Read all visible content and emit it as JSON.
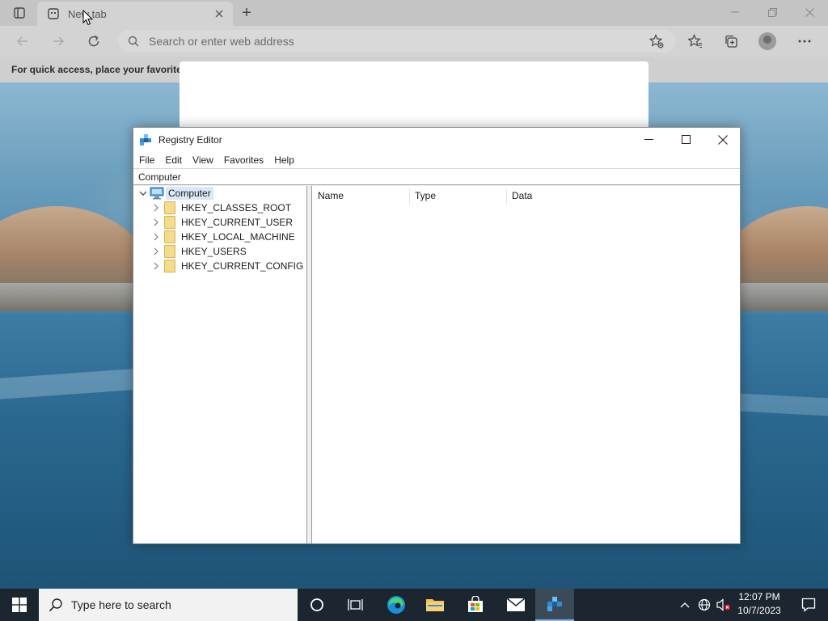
{
  "browser": {
    "tab_title": "New tab",
    "new_tab_symbol": "+",
    "address_placeholder": "Search or enter web address",
    "favorites_bar_text": "For quick access, place your favorites h",
    "icons": [
      "tab-actions-icon",
      "back-icon",
      "forward-icon",
      "refresh-icon",
      "search-icon",
      "add-favorite-icon",
      "favorites-icon",
      "collections-icon",
      "profile-icon",
      "more-icon"
    ]
  },
  "regedit": {
    "title": "Registry Editor",
    "menus": [
      "File",
      "Edit",
      "View",
      "Favorites",
      "Help"
    ],
    "address_path": "Computer",
    "tree_root": "Computer",
    "tree_items": [
      "HKEY_CLASSES_ROOT",
      "HKEY_CURRENT_USER",
      "HKEY_LOCAL_MACHINE",
      "HKEY_USERS",
      "HKEY_CURRENT_CONFIG"
    ],
    "columns": [
      "Name",
      "Type",
      "Data"
    ]
  },
  "taskbar": {
    "search_placeholder": "Type here to search",
    "time": "12:07 PM",
    "date": "10/7/2023",
    "apps": [
      "cortana-icon",
      "task-view-icon",
      "edge-icon",
      "file-explorer-icon",
      "store-icon",
      "mail-icon",
      "registry-editor-icon"
    ]
  },
  "colors": {
    "taskbar_bg": "#1c2630",
    "selection_bg": "#d9e8f7",
    "folder_yellow": "#f4dc8a"
  }
}
